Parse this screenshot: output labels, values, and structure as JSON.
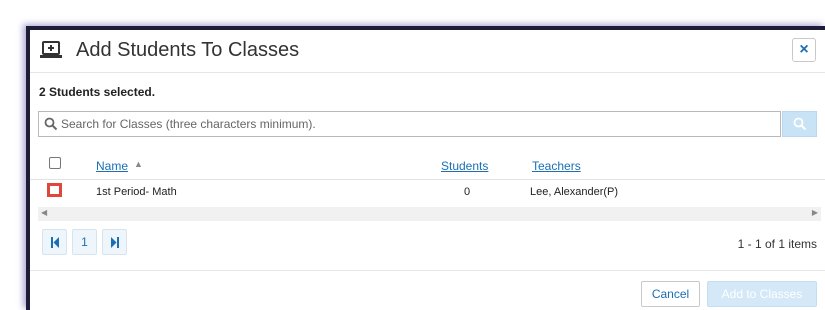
{
  "dialog": {
    "title": "Add Students To Classes",
    "close_label": "×",
    "selected_text": "2 Students selected."
  },
  "search": {
    "placeholder": "Search for Classes (three characters minimum)."
  },
  "grid": {
    "columns": {
      "name": "Name",
      "students": "Students",
      "teachers": "Teachers"
    },
    "rows": [
      {
        "name": "1st Period- Math",
        "students": "0",
        "teachers": "Lee, Alexander(P)"
      }
    ]
  },
  "pager": {
    "page": "1",
    "items_info": "1 - 1 of 1 items"
  },
  "footer": {
    "cancel_label": "Cancel",
    "add_label": "Add to Classes"
  },
  "colors": {
    "accent": "#1a6fb5",
    "row_checkbox_highlight": "#e0463a",
    "primary_disabled": "#d4e8f7"
  },
  "icons": {
    "header": "laptop-plus-icon",
    "search": "search-icon",
    "close": "close-icon",
    "first_page": "first-page-icon",
    "last_page": "last-page-icon"
  }
}
